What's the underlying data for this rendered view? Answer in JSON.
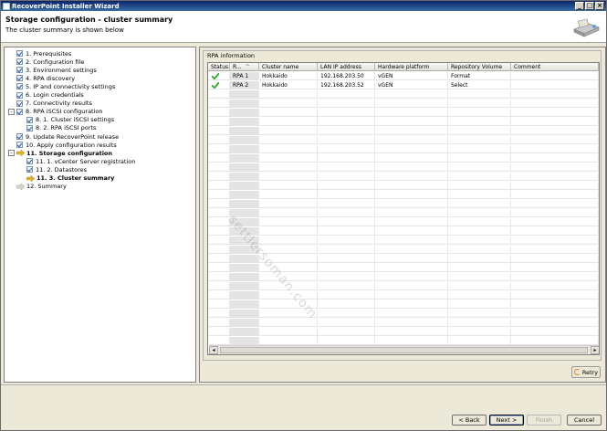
{
  "window": {
    "title": "RecoverPoint Installer Wizard",
    "min_glyph": "_",
    "max_glyph": "□",
    "close_glyph": "×"
  },
  "header": {
    "title": "Storage configuration - cluster summary",
    "subtitle": "The cluster summary is shown below",
    "logo_icon": "installer-box-icon"
  },
  "steps": [
    {
      "label": "1. Prerequisites",
      "level": 0,
      "state": "done"
    },
    {
      "label": "2. Configuration file",
      "level": 0,
      "state": "done"
    },
    {
      "label": "3. Environment settings",
      "level": 0,
      "state": "done"
    },
    {
      "label": "4. RPA discovery",
      "level": 0,
      "state": "done"
    },
    {
      "label": "5. IP and connectivity settings",
      "level": 0,
      "state": "done"
    },
    {
      "label": "6. Login credentials",
      "level": 0,
      "state": "done"
    },
    {
      "label": "7. Connectivity results",
      "level": 0,
      "state": "done"
    },
    {
      "label": "8. RPA iSCSI configuration",
      "level": 0,
      "state": "done",
      "expander": "-"
    },
    {
      "label": "8. 1. Cluster iSCSI settings",
      "level": 1,
      "state": "done"
    },
    {
      "label": "8. 2. RPA iSCSI ports",
      "level": 1,
      "state": "done"
    },
    {
      "label": "9. Update RecoverPoint release",
      "level": 0,
      "state": "done"
    },
    {
      "label": "10. Apply configuration results",
      "level": 0,
      "state": "done"
    },
    {
      "label": "11. Storage configuration",
      "level": 0,
      "state": "current-parent",
      "expander": "-"
    },
    {
      "label": "11. 1. vCenter Server registration",
      "level": 1,
      "state": "done"
    },
    {
      "label": "11. 2. Datastores",
      "level": 1,
      "state": "done"
    },
    {
      "label": "11. 3. Cluster summary",
      "level": 1,
      "state": "current"
    },
    {
      "label": "12. Summary",
      "level": 0,
      "state": "pending"
    }
  ],
  "rpa_info": {
    "legend": "RPA information",
    "columns": [
      "Status",
      "R...",
      "Cluster name",
      "LAN IP address",
      "Hardware platform",
      "Repository Volume",
      "Comment"
    ],
    "sort_glyph": "^",
    "rows": [
      {
        "status": "ok",
        "rpa": "RPA 1",
        "cluster": "Hokkaido",
        "ip": "192.168.203.50",
        "platform": "vGEN",
        "repo": "Format",
        "comment": ""
      },
      {
        "status": "ok",
        "rpa": "RPA 2",
        "cluster": "Hokkaido",
        "ip": "192.168.203.52",
        "platform": "vGEN",
        "repo": "Select",
        "comment": ""
      }
    ],
    "empty_rows": 29,
    "scroll_left": "◂",
    "scroll_right": "▸"
  },
  "buttons": {
    "retry": "Retry",
    "back": "< Back",
    "next": "Next >",
    "finish": "Finish",
    "cancel": "Cancel"
  },
  "watermark": "settlersoman.com",
  "colors": {
    "title_bar": "#0a246a",
    "check_green": "#2eaa2e",
    "current_arrow": "#e8b020"
  }
}
